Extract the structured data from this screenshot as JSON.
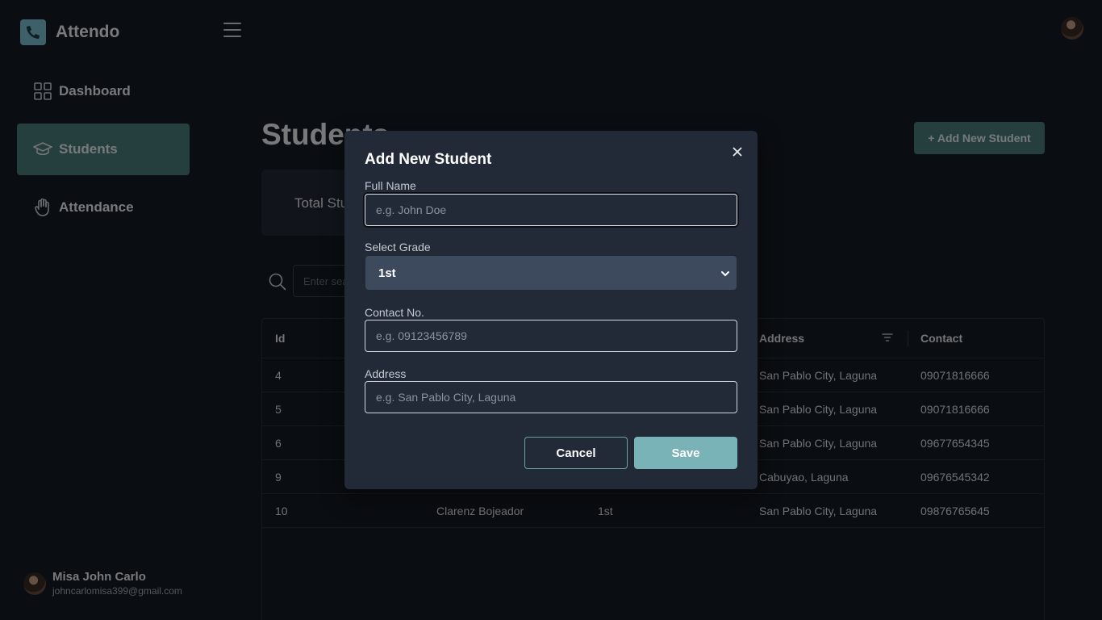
{
  "app": {
    "name": "Attendo"
  },
  "sidebar": {
    "items": [
      {
        "label": "Dashboard",
        "icon": "dashboard-grid-icon"
      },
      {
        "label": "Students",
        "icon": "graduation-cap-icon",
        "active": true
      },
      {
        "label": "Attendance",
        "icon": "hand-icon"
      }
    ]
  },
  "user": {
    "name": "Misa John Carlo",
    "email": "johncarlomisa399@gmail.com"
  },
  "page": {
    "title": "Students",
    "add_button": "+ Add New Student",
    "stats_label": "Total Students",
    "search_placeholder": "Enter search"
  },
  "table": {
    "columns": [
      "Id",
      "Address",
      "Contact"
    ],
    "rows": [
      {
        "id": "4",
        "name": "",
        "grade": "",
        "address": "San Pablo City, Laguna",
        "contact": "09071816666"
      },
      {
        "id": "5",
        "name": "",
        "grade": "",
        "address": "San Pablo City, Laguna",
        "contact": "09071816666"
      },
      {
        "id": "6",
        "name": "",
        "grade": "",
        "address": "San Pablo City, Laguna",
        "contact": "09677654345"
      },
      {
        "id": "9",
        "name": "",
        "grade": "",
        "address": "Cabuyao, Laguna",
        "contact": "09676545342"
      },
      {
        "id": "10",
        "name": "Clarenz Bojeador",
        "grade": "1st",
        "address": "San Pablo City, Laguna",
        "contact": "09876765645"
      }
    ]
  },
  "modal": {
    "title": "Add New Student",
    "full_name_label": "Full Name",
    "full_name_placeholder": "e.g. John Doe",
    "grade_label": "Select Grade",
    "grade_value": "1st",
    "contact_label": "Contact No.",
    "contact_placeholder": "e.g. 09123456789",
    "address_label": "Address",
    "address_placeholder": "e.g. San Pablo City, Laguna",
    "cancel_label": "Cancel",
    "save_label": "Save"
  },
  "colors": {
    "accent": "#4a7e7e",
    "save": "#7ab3b7",
    "background": "#141a22",
    "modal": "#212a36"
  }
}
